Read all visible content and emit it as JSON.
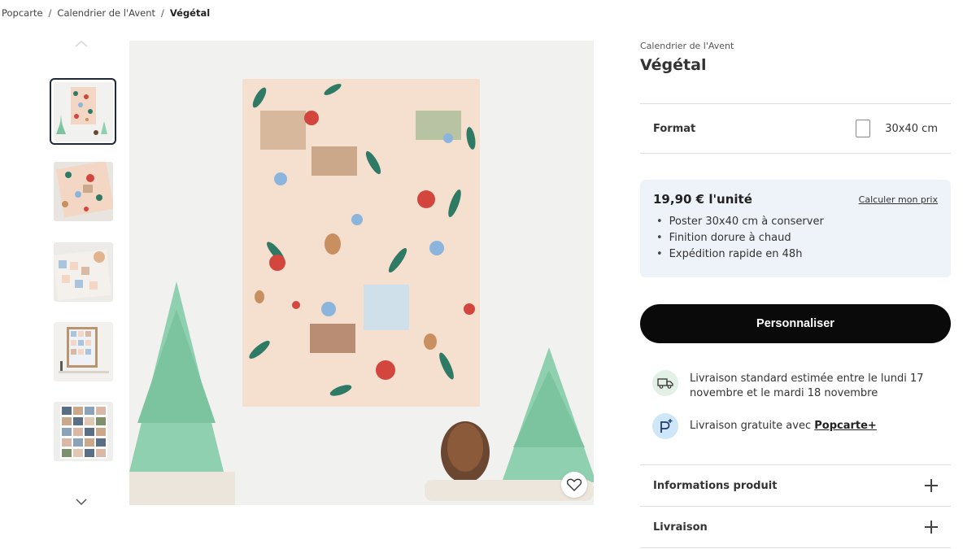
{
  "breadcrumb": {
    "items": [
      "Popcarte",
      "Calendrier de l'Avent",
      "Végétal"
    ],
    "separator": "/"
  },
  "gallery": {
    "thumbnails": [
      "thumbnail-poster-front",
      "thumbnail-poster-flatlay",
      "thumbnail-poster-hand",
      "thumbnail-poster-framed",
      "thumbnail-poster-photos"
    ],
    "active_index": 0
  },
  "product": {
    "category": "Calendrier de l'Avent",
    "title": "Végétal"
  },
  "format": {
    "label": "Format",
    "value": "30x40 cm"
  },
  "pricing": {
    "price": "19,90 € l'unité",
    "calc_link": "Calculer mon prix",
    "features": [
      "Poster 30x40 cm à conserver",
      "Finition dorure à chaud",
      "Expédition rapide en 48h"
    ]
  },
  "cta": {
    "label": "Personnaliser"
  },
  "shipping": {
    "standard": "Livraison standard estimée entre le lundi 17 novembre et le mardi 18 novembre",
    "free_prefix": "Livraison gratuite avec ",
    "free_link": "Popcarte+"
  },
  "accordions": {
    "info": "Informations produit",
    "delivery": "Livraison"
  },
  "colors": {
    "accent_black": "#0a0a0a",
    "price_box_bg": "#eef3fa",
    "truck_icon_bg": "#e3f0e6",
    "popcarte_icon_bg": "#cfe6f8",
    "poster_bg": "#f5dfcf",
    "tree_green": "#8fd0b0"
  }
}
